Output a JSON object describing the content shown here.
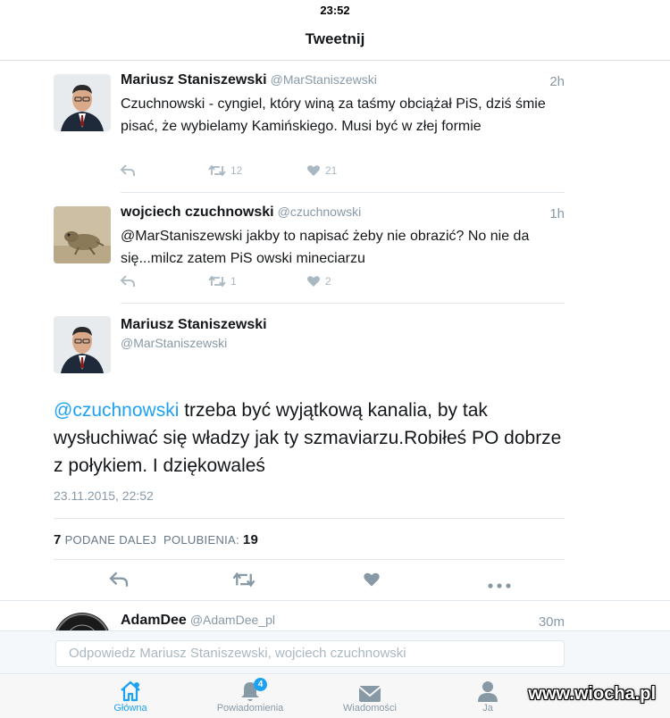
{
  "status_bar": {
    "time": "23:52"
  },
  "nav": {
    "title": "Tweetnij"
  },
  "replies": [
    {
      "name": "Mariusz Staniszewski",
      "handle": "@MarStaniszewski",
      "time": "2h",
      "text": "Czuchnowski - cyngiel, który winą za taśmy obciążał PiS, dziś śmie pisać, że wybielamy Kamińskiego. Musi być w złej formie",
      "retweets": "12",
      "likes": "21"
    },
    {
      "name": "wojciech czuchnowski",
      "handle": "@czuchnowski",
      "time": "1h",
      "text": "@MarStaniszewski jakby to napisać żeby nie obrazić? No nie da się...milcz zatem PiS owski mineciarzu",
      "retweets": "1",
      "likes": "2"
    }
  ],
  "main_tweet": {
    "name": "Mariusz Staniszewski",
    "handle": "@MarStaniszewski",
    "mention": "@czuchnowski",
    "text": " trzeba być wyjątkową kanalia, by tak wysłuchiwać się władzy jak ty szmaviarzu.Robiłeś PO dobrze z połykiem. I  dziękowaleś",
    "date": "23.11.2015, 22:52",
    "retweet_count": "7",
    "retweet_label": "PODANE DALEJ",
    "like_label": "POLUBIENIA:",
    "like_count": "19"
  },
  "third_tweet": {
    "name": "AdamDee",
    "handle": "@AdamDee_pl",
    "time": "30m"
  },
  "reply_box": {
    "placeholder": "Odpowiedz Mariusz Staniszewski, wojciech czuchnowski"
  },
  "tabs": [
    {
      "label": "Główna",
      "icon": "home-icon",
      "active": true
    },
    {
      "label": "Powiadomienia",
      "icon": "bell-icon",
      "badge": "4"
    },
    {
      "label": "Wiadomości",
      "icon": "envelope-icon"
    },
    {
      "label": "Ja",
      "icon": "person-icon"
    }
  ],
  "watermark": "www.wiocha.pl",
  "colors": {
    "accent": "#1da1f2",
    "muted": "#8899a6",
    "text": "#14171a"
  }
}
